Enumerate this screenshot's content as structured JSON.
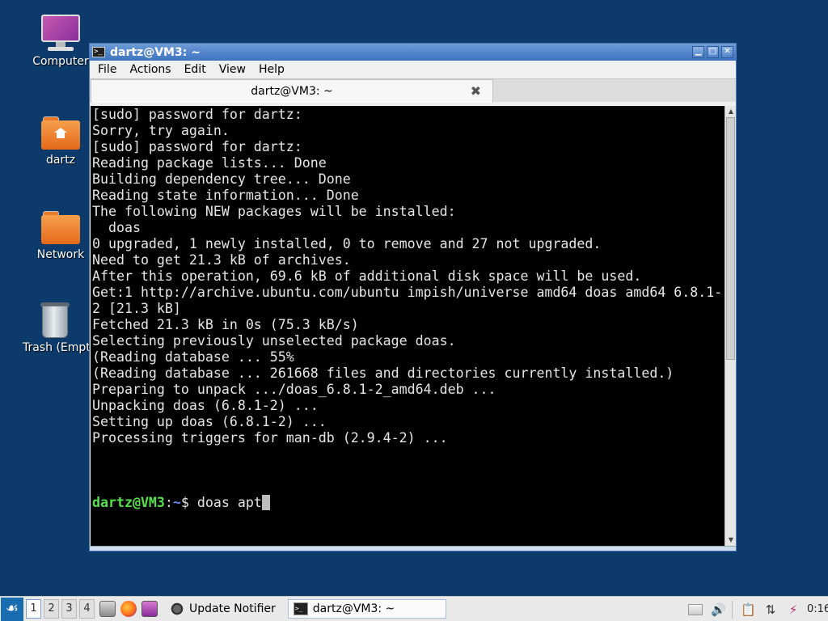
{
  "desktop": {
    "icons": [
      {
        "label": "Computer",
        "icon": "computer-icon"
      },
      {
        "label": "dartz",
        "icon": "home-folder-icon"
      },
      {
        "label": "Network",
        "icon": "folder-icon"
      },
      {
        "label": "Trash (Empty)",
        "icon": "trash-icon"
      }
    ]
  },
  "window": {
    "title": "dartz@VM3: ~",
    "buttons": {
      "minimize": "▁",
      "maximize": "□",
      "close": "✕"
    },
    "menu": [
      "File",
      "Actions",
      "Edit",
      "View",
      "Help"
    ],
    "tab": {
      "label": "dartz@VM3: ~",
      "close": "✖"
    }
  },
  "terminal": {
    "lines": [
      "[sudo] password for dartz:",
      "Sorry, try again.",
      "[sudo] password for dartz:",
      "Reading package lists... Done",
      "Building dependency tree... Done",
      "Reading state information... Done",
      "The following NEW packages will be installed:",
      "  doas",
      "0 upgraded, 1 newly installed, 0 to remove and 27 not upgraded.",
      "Need to get 21.3 kB of archives.",
      "After this operation, 69.6 kB of additional disk space will be used.",
      "Get:1 http://archive.ubuntu.com/ubuntu impish/universe amd64 doas amd64 6.8.1-",
      "2 [21.3 kB]",
      "Fetched 21.3 kB in 0s (75.3 kB/s)",
      "Selecting previously unselected package doas.",
      "(Reading database ... 55%",
      "(Reading database ... 261668 files and directories currently installed.)",
      "Preparing to unpack .../doas_6.8.1-2_amd64.deb ...",
      "Unpacking doas (6.8.1-2) ...",
      "Setting up doas (6.8.1-2) ...",
      "Processing triggers for man-db (2.9.4-2) ...",
      "",
      "",
      ""
    ],
    "prompt": {
      "user_host": "dartz@VM3",
      "sep": ":",
      "path": "~",
      "symbol": "$",
      "command": " doas apt"
    }
  },
  "taskbar": {
    "start": "☙",
    "desktops": [
      "1",
      "2",
      "3",
      "4"
    ],
    "launchers": [
      "file-manager-icon",
      "firefox-icon",
      "media-player-icon"
    ],
    "tasks": [
      {
        "label": "Update Notifier",
        "icon": "update-notifier-icon"
      },
      {
        "label": "dartz@VM3: ~",
        "icon": "terminal-icon"
      }
    ],
    "tray": {
      "volume": "🔊",
      "clipboard": "📋",
      "network": "⇅",
      "power": "⚡"
    },
    "clock": "0:16"
  }
}
